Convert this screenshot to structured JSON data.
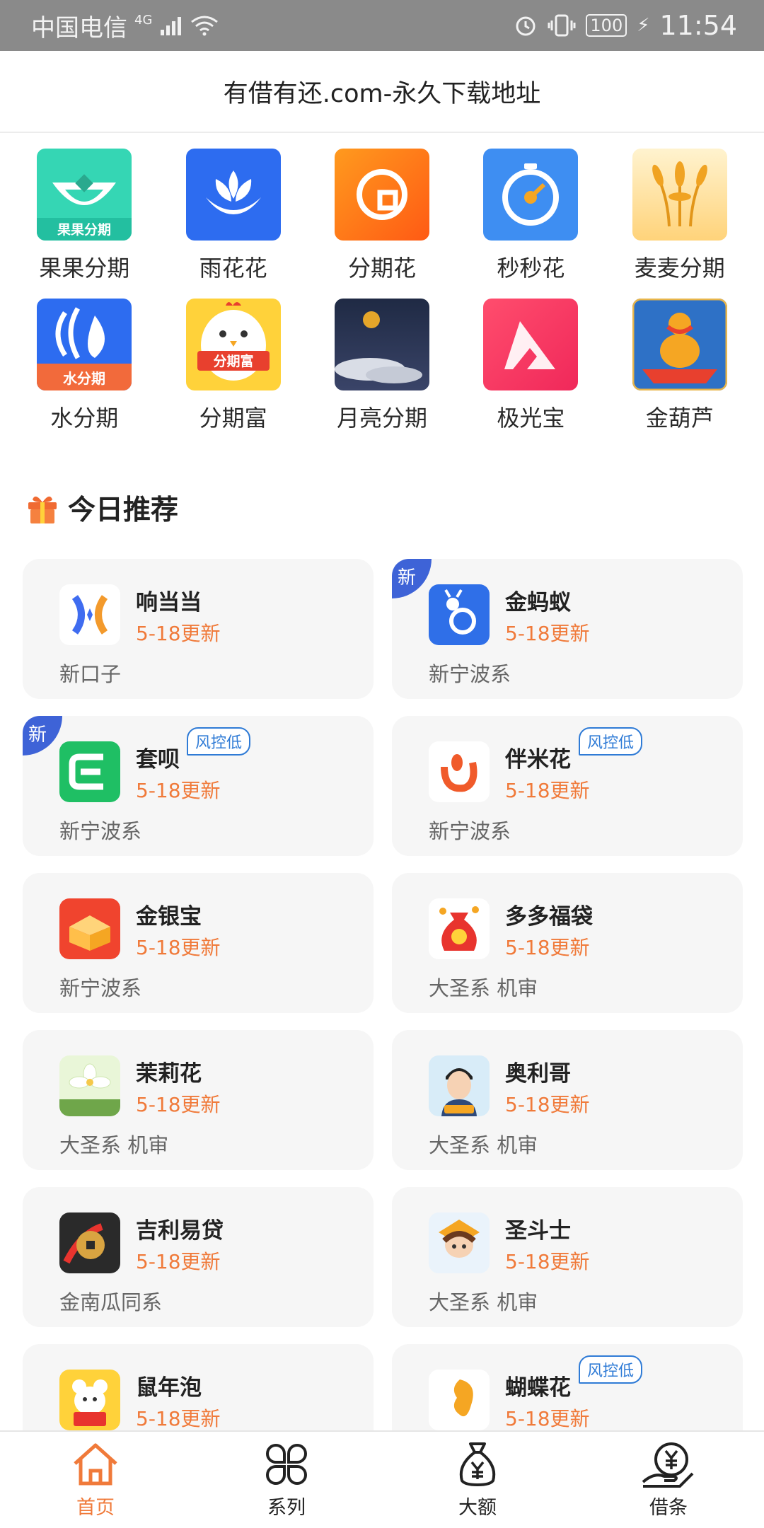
{
  "status_bar": {
    "carrier": "中国电信",
    "network": "4G",
    "battery": "100",
    "time": "11:54"
  },
  "header": {
    "title": "有借有还.com-永久下载地址"
  },
  "apps": [
    {
      "label": "果果分期",
      "icon": "guoguo-icon",
      "icon_text": "果果分期"
    },
    {
      "label": "雨花花",
      "icon": "lotus-icon"
    },
    {
      "label": "分期花",
      "icon": "fenqihua-icon"
    },
    {
      "label": "秒秒花",
      "icon": "stopwatch-icon"
    },
    {
      "label": "麦麦分期",
      "icon": "wheat-icon"
    },
    {
      "label": "水分期",
      "icon": "water-icon",
      "icon_text": "水分期"
    },
    {
      "label": "分期富",
      "icon": "chick-icon",
      "icon_text": "分期富"
    },
    {
      "label": "月亮分期",
      "icon": "moon-icon"
    },
    {
      "label": "极光宝",
      "icon": "aurora-icon"
    },
    {
      "label": "金葫芦",
      "icon": "gourd-icon"
    }
  ],
  "section": {
    "title": "今日推荐"
  },
  "cards": [
    {
      "name": "响当当",
      "date": "5-18更新",
      "tag": "新口子",
      "new": false,
      "risk": ""
    },
    {
      "name": "金蚂蚁",
      "date": "5-18更新",
      "tag": "新宁波系",
      "new": true,
      "risk": ""
    },
    {
      "name": "套呗",
      "date": "5-18更新",
      "tag": "新宁波系",
      "new": true,
      "risk": "风控低"
    },
    {
      "name": "伴米花",
      "date": "5-18更新",
      "tag": "新宁波系",
      "new": false,
      "risk": "风控低"
    },
    {
      "name": "金银宝",
      "date": "5-18更新",
      "tag": "新宁波系",
      "new": false,
      "risk": ""
    },
    {
      "name": "多多福袋",
      "date": "5-18更新",
      "tag": "大圣系 机审",
      "new": false,
      "risk": ""
    },
    {
      "name": "茉莉花",
      "date": "5-18更新",
      "tag": "大圣系 机审",
      "new": false,
      "risk": ""
    },
    {
      "name": "奥利哥",
      "date": "5-18更新",
      "tag": "大圣系 机审",
      "new": false,
      "risk": ""
    },
    {
      "name": "吉利易贷",
      "date": "5-18更新",
      "tag": "金南瓜同系",
      "new": false,
      "risk": ""
    },
    {
      "name": "圣斗士",
      "date": "5-18更新",
      "tag": "大圣系 机审",
      "new": false,
      "risk": ""
    },
    {
      "name": "鼠年泡",
      "date": "5-18更新",
      "tag": "",
      "new": false,
      "risk": ""
    },
    {
      "name": "蝴蝶花",
      "date": "5-18更新",
      "tag": "",
      "new": false,
      "risk": "风控低"
    }
  ],
  "badge_new_label": "新",
  "nav": [
    {
      "label": "首页",
      "icon": "home-icon",
      "active": true
    },
    {
      "label": "系列",
      "icon": "grid-icon",
      "active": false
    },
    {
      "label": "大额",
      "icon": "money-bag-icon",
      "active": false
    },
    {
      "label": "借条",
      "icon": "yuan-hand-icon",
      "active": false
    }
  ],
  "colors": {
    "accent": "#f07a3a",
    "new_badge": "#3e63d7",
    "risk_tag": "#2f7bd6"
  }
}
